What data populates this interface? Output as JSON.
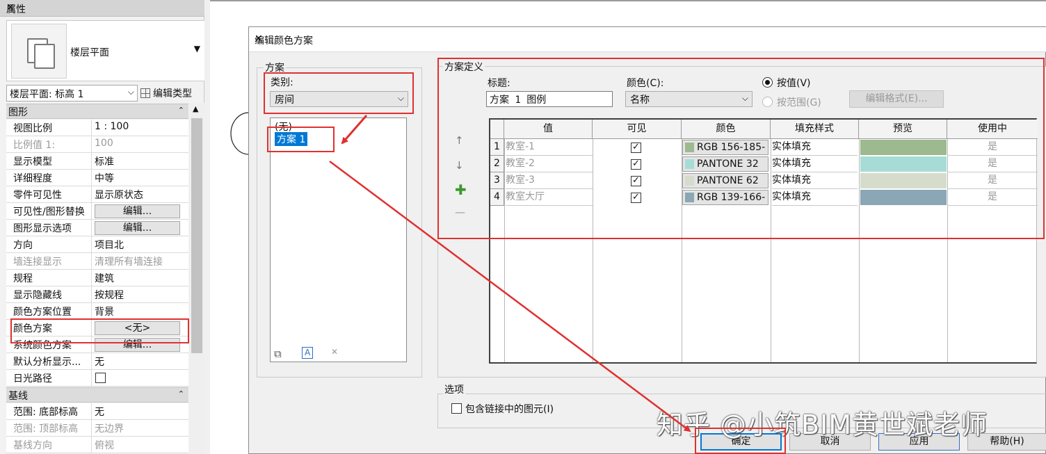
{
  "properties": {
    "title": "属性",
    "close": "✕",
    "type_name": "楼层平面",
    "instance_selector": "楼层平面: 标高 1",
    "edit_type": "编辑类型",
    "groups": {
      "graphics": "图形",
      "underlay": "基线"
    },
    "rows": [
      {
        "label": "视图比例",
        "value": "1 : 100"
      },
      {
        "label": "比例值 1:",
        "value": "100"
      },
      {
        "label": "显示模型",
        "value": "标准"
      },
      {
        "label": "详细程度",
        "value": "中等"
      },
      {
        "label": "零件可见性",
        "value": "显示原状态"
      },
      {
        "label": "可见性/图形替换",
        "value": "编辑..."
      },
      {
        "label": "图形显示选项",
        "value": "编辑..."
      },
      {
        "label": "方向",
        "value": "项目北"
      },
      {
        "label": "墙连接显示",
        "value": "清理所有墙连接"
      },
      {
        "label": "规程",
        "value": "建筑"
      },
      {
        "label": "显示隐藏线",
        "value": "按规程"
      },
      {
        "label": "颜色方案位置",
        "value": "背景"
      },
      {
        "label": "颜色方案",
        "value": "<无>"
      },
      {
        "label": "系统颜色方案",
        "value": "编辑..."
      },
      {
        "label": "默认分析显示...",
        "value": "无"
      },
      {
        "label": "日光路径",
        "value": ""
      }
    ],
    "underlay_rows": [
      {
        "label": "范围: 底部标高",
        "value": "无"
      },
      {
        "label": "范围: 顶部标高",
        "value": "无边界"
      },
      {
        "label": "基线方向",
        "value": "俯视"
      }
    ]
  },
  "dialog": {
    "title": "编辑颜色方案",
    "close": "✕",
    "scheme_group": "方案",
    "category_label": "类别:",
    "category_value": "房间",
    "schemes": [
      "(无)",
      "方案 1"
    ],
    "definition_group": "方案定义",
    "title_label": "标题:",
    "title_value": "方案 1 图例",
    "color_label": "颜色(C):",
    "color_value": "名称",
    "by_value": "按值(V)",
    "by_range": "按范围(G)",
    "edit_format": "编辑格式(E)...",
    "columns": [
      "值",
      "可见",
      "颜色",
      "填充样式",
      "预览",
      "使用中"
    ],
    "rows": [
      {
        "n": "1",
        "value": "教室-1",
        "visible": "✓",
        "color_text": "RGB 156-185-",
        "swatch": "#9cb98f",
        "fill": "实体填充",
        "preview": "#9cb98f",
        "in_use": "是"
      },
      {
        "n": "2",
        "value": "教室-2",
        "visible": "✓",
        "color_text": "PANTONE 32",
        "swatch": "#a7dcd6",
        "fill": "实体填充",
        "preview": "#a7dcd6",
        "in_use": "是"
      },
      {
        "n": "3",
        "value": "教室-3",
        "visible": "✓",
        "color_text": "PANTONE 62",
        "swatch": "#d5dccc",
        "fill": "实体填充",
        "preview": "#d5dccc",
        "in_use": "是"
      },
      {
        "n": "4",
        "value": "教室大厅",
        "visible": "✓",
        "color_text": "RGB 139-166-",
        "swatch": "#8ba6b4",
        "fill": "实体填充",
        "preview": "#8ba6b4",
        "in_use": "是"
      }
    ],
    "options_group": "选项",
    "include_links": "包含链接中的图元(I)",
    "buttons": {
      "ok": "确定",
      "cancel": "取消",
      "apply": "应用",
      "help": "帮助(H)"
    }
  },
  "icons": {
    "move_up": "↑",
    "move_down": "↓",
    "add": "✚",
    "remove": "—",
    "duplicate": "⧉",
    "rename": "A",
    "delete": "✕"
  },
  "watermark": "知乎 @小筑BIM黄世斌老师",
  "colors": {
    "accent": "#0078d7",
    "annotation": "#e03030"
  }
}
